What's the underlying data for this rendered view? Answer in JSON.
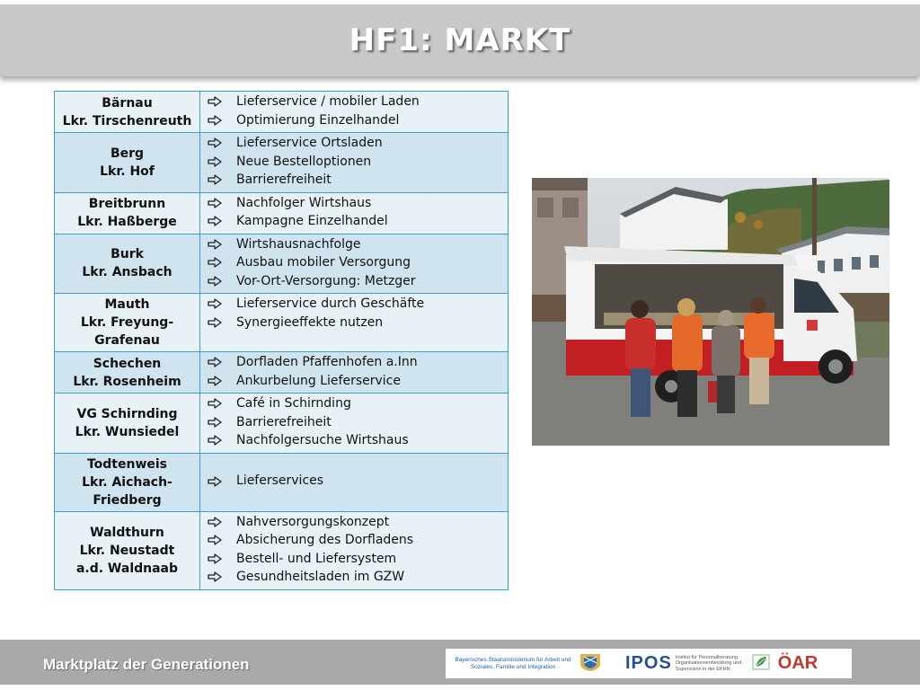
{
  "slide": {
    "title": "HF1:  MARKT"
  },
  "table": {
    "rows": [
      {
        "location": [
          "Bärnau",
          "Lkr. Tirschenreuth"
        ],
        "items": [
          "Lieferservice / mobiler Laden",
          "Optimierung Einzelhandel"
        ]
      },
      {
        "location": [
          "Berg",
          "Lkr. Hof"
        ],
        "items": [
          "Lieferservice Ortsladen",
          "Neue Bestelloptionen",
          "Barrierefreiheit"
        ]
      },
      {
        "location": [
          "Breitbrunn",
          "Lkr. Haßberge"
        ],
        "items": [
          "Nachfolger Wirtshaus",
          "Kampagne Einzelhandel"
        ]
      },
      {
        "location": [
          "Burk",
          "Lkr. Ansbach"
        ],
        "items": [
          "Wirtshausnachfolge",
          "Ausbau mobiler Versorgung",
          "Vor-Ort-Versorgung: Metzger"
        ]
      },
      {
        "location": [
          "Mauth",
          "Lkr. Freyung-",
          "Grafenau"
        ],
        "items": [
          "Lieferservice durch Geschäfte",
          "Synergieeffekte nutzen"
        ],
        "align_top": true
      },
      {
        "location": [
          "Schechen",
          "Lkr. Rosenheim"
        ],
        "items": [
          "Dorfladen Pfaffenhofen a.Inn",
          "Ankurbelung Lieferservice"
        ]
      },
      {
        "location": [
          "VG Schirnding",
          "Lkr. Wunsiedel"
        ],
        "items": [
          "Café in Schirnding",
          "Barrierefreiheit",
          "Nachfolgersuche Wirtshaus"
        ]
      },
      {
        "location": [
          "Todtenweis",
          "Lkr. Aichach-",
          "Friedberg"
        ],
        "items": [
          "Lieferservices"
        ]
      },
      {
        "location": [
          "Waldthurn",
          "Lkr. Neustadt",
          "a.d. Waldnaab"
        ],
        "items": [
          "Nahversorgungskonzept",
          "Absicherung des Dorfladens",
          "Bestell- und Liefersystem",
          "Gesundheitsladen im GZW"
        ]
      }
    ]
  },
  "footer": {
    "project": "Marktplatz der Generationen",
    "ministry": "Bayerisches Staatsministerium für Arbeit und Soziales, Familie und Integration",
    "ipos": "IPOS",
    "ipos_description": "Institut für Personalberatung Organisationsentwicklung und Supervision in der EKHN",
    "oear": "ÖAR"
  },
  "icons": {
    "bullet": "hollow-right-arrow-icon",
    "ministry_crest": "bavarian-crest-icon",
    "leaf": "leaf-logo-icon"
  },
  "colors": {
    "table_border": "#3aa0c8",
    "row_light": "#e8f1f6",
    "row_dark": "#cfe4ef",
    "title_bar": "#c8c8c8",
    "footer_bar": "#a9a9a9"
  }
}
